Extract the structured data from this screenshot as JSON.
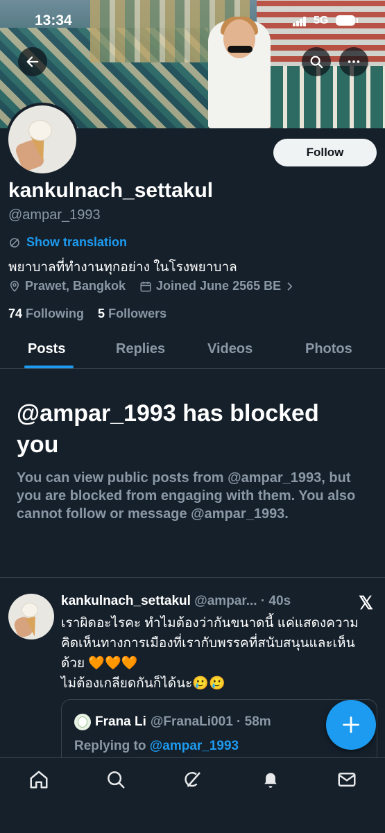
{
  "status_bar": {
    "time": "13:34",
    "network": "5G"
  },
  "header": {
    "back_icon": "arrow-left-icon",
    "search_icon": "search-icon",
    "more_icon": "more-horizontal-icon"
  },
  "profile": {
    "follow_label": "Follow",
    "display_name": "kankulnach_settakul",
    "handle": "@ampar_1993",
    "show_translation": "Show translation",
    "bio": "พยาบาลที่ทำงานทุกอย่าง ในโรงพยาบาล",
    "location": "Prawet, Bangkok",
    "joined": "Joined June 2565 BE",
    "following_count": "74",
    "following_label": "Following",
    "followers_count": "5",
    "followers_label": "Followers"
  },
  "tabs": [
    {
      "label": "Posts",
      "active": true
    },
    {
      "label": "Replies",
      "active": false
    },
    {
      "label": "Videos",
      "active": false
    },
    {
      "label": "Photos",
      "active": false
    }
  ],
  "blocked": {
    "title": "@ampar_1993 has blocked you",
    "text": "You can view public posts from @ampar_1993, but you are blocked from engaging with them. You also cannot follow or message @ampar_1993."
  },
  "post": {
    "author": "kankulnach_settakul",
    "handle_time": "@ampar... · 40s",
    "text": "เราผิดอะไรคะ ทำไมต้องว่ากันขนาดนี้ แค่แสดงความคิดเห็นทางการเมืองที่เรากับพรรคที่สนับสนุนและเห็นด้วย 🧡🧡🧡\n ไม่ต้องเกลียดกันก็ได้นะ🥲🥲",
    "x_logo": "𝕏",
    "quote": {
      "name": "Frana Li",
      "handle_time": "@FranaLi001 · 58m",
      "replying_to_label": "Replying to",
      "replying_to": "@ampar_1993"
    }
  },
  "fab_label": "+",
  "bottom_nav": [
    "home-icon",
    "search-icon",
    "grok-icon",
    "notifications-icon",
    "messages-icon"
  ],
  "colors": {
    "accent": "#1d9bf0",
    "background": "#15202b",
    "secondary_text": "#8b98a5"
  }
}
